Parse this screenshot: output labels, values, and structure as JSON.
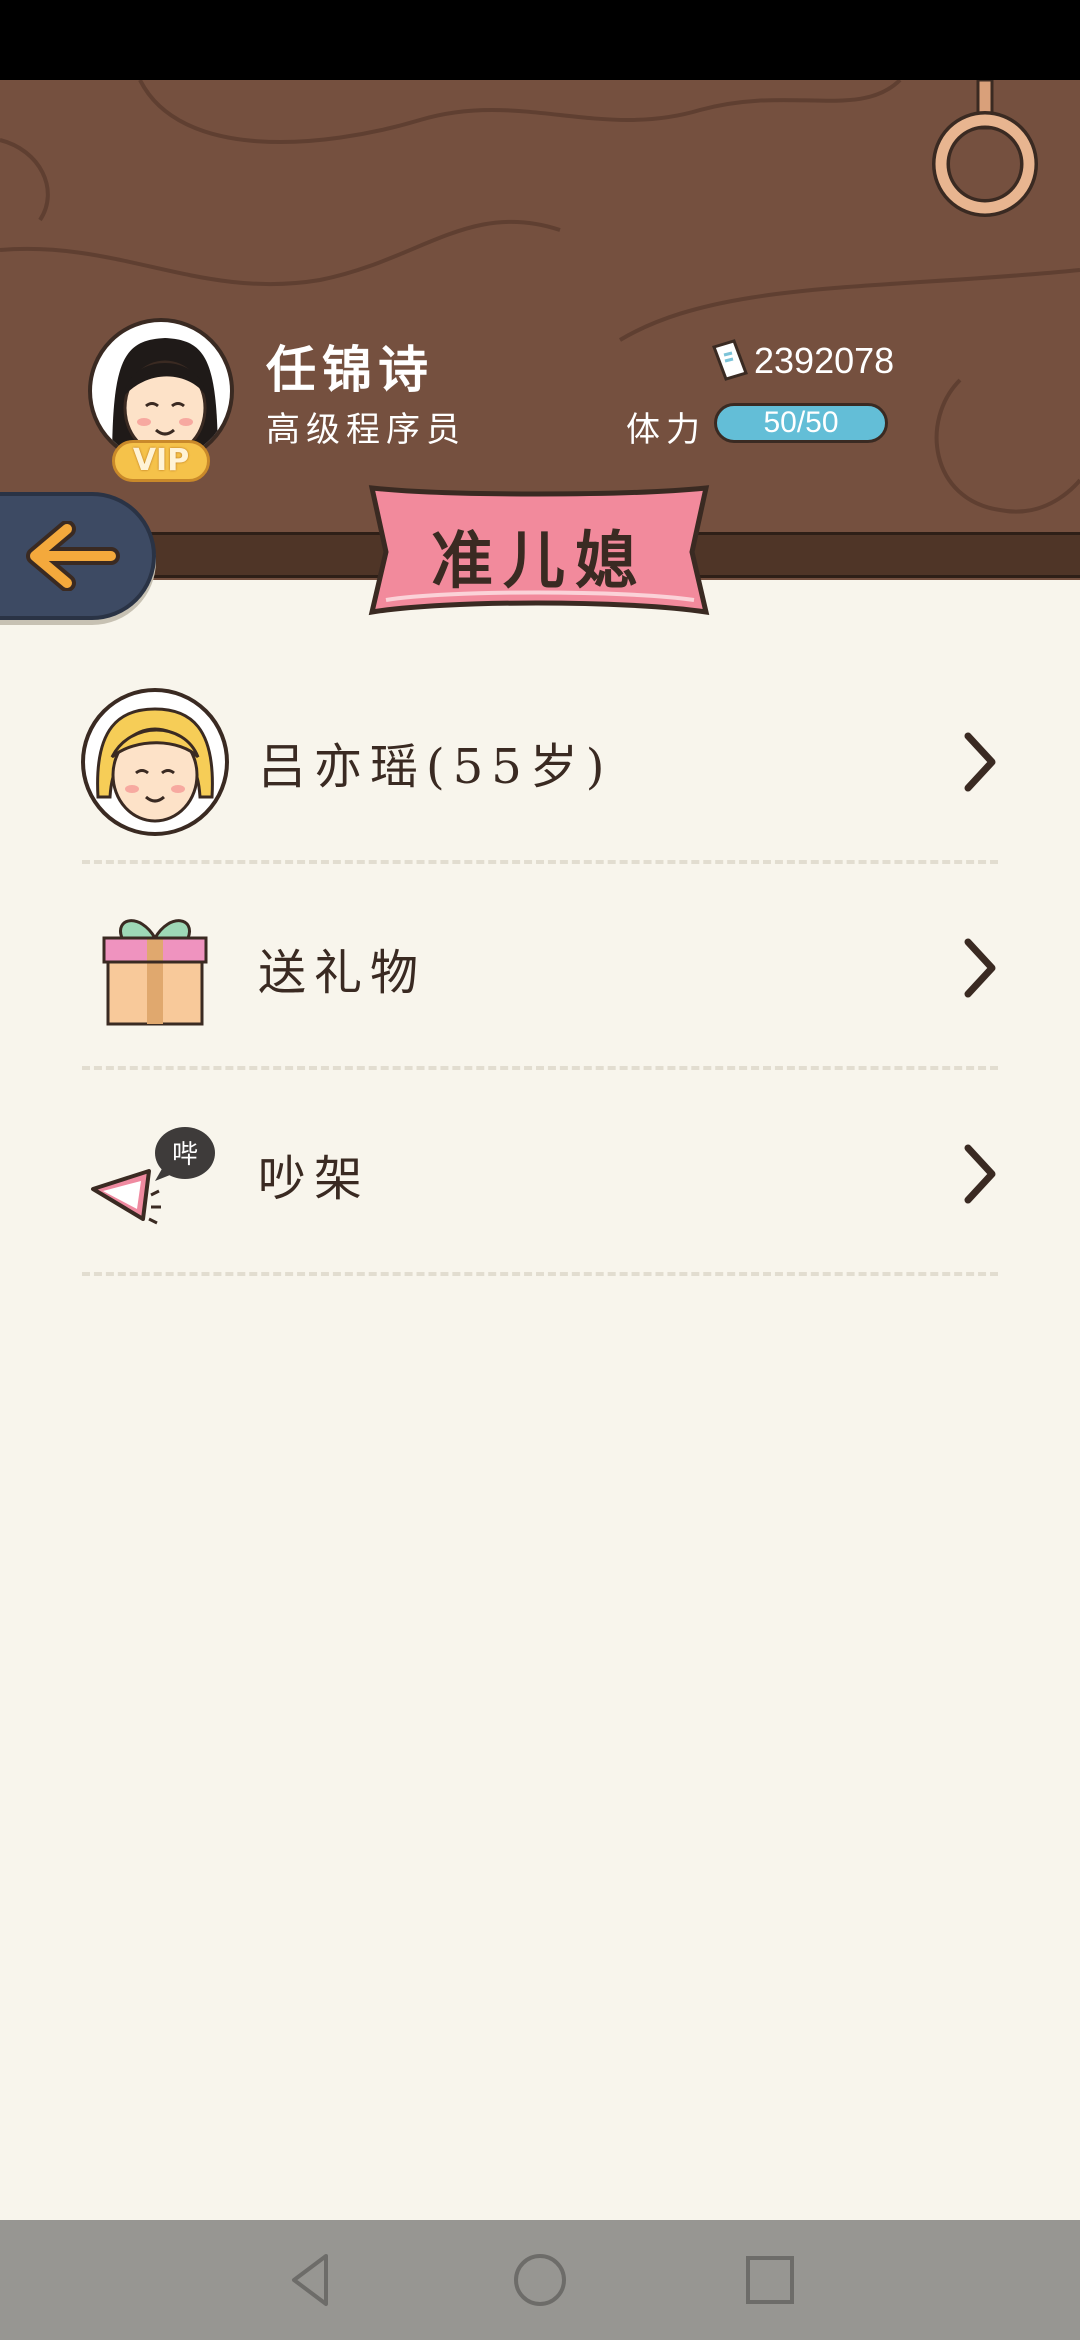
{
  "player": {
    "name": "任锦诗",
    "title": "高级程序员",
    "vip_label": "VIP",
    "money": "2392078",
    "stamina_label": "体力",
    "stamina_value": "50/50",
    "stamina_fraction": 1.0
  },
  "page": {
    "title": "准儿媳"
  },
  "list": {
    "items": [
      {
        "label": "吕亦瑶(55岁)",
        "icon": "girl-avatar-icon"
      },
      {
        "label": "送礼物",
        "icon": "gift-box-icon"
      },
      {
        "label": "吵架",
        "icon": "quarrel-mouth-icon"
      }
    ]
  },
  "icons": {
    "back": "back-arrow-icon",
    "money": "money-note-icon",
    "ring": "hanging-ring-icon",
    "chevron": "chevron-right-icon",
    "nav_back": "nav-back-icon",
    "nav_home": "nav-home-icon",
    "nav_recents": "nav-recents-icon"
  },
  "colors": {
    "header_wood": "#75503f",
    "banner_pink": "#f28a9c",
    "stamina_blue": "#63bed7",
    "vip_gold": "#f5c24a",
    "back_button": "#3d4a63",
    "arrow_orange": "#f4a93c"
  }
}
